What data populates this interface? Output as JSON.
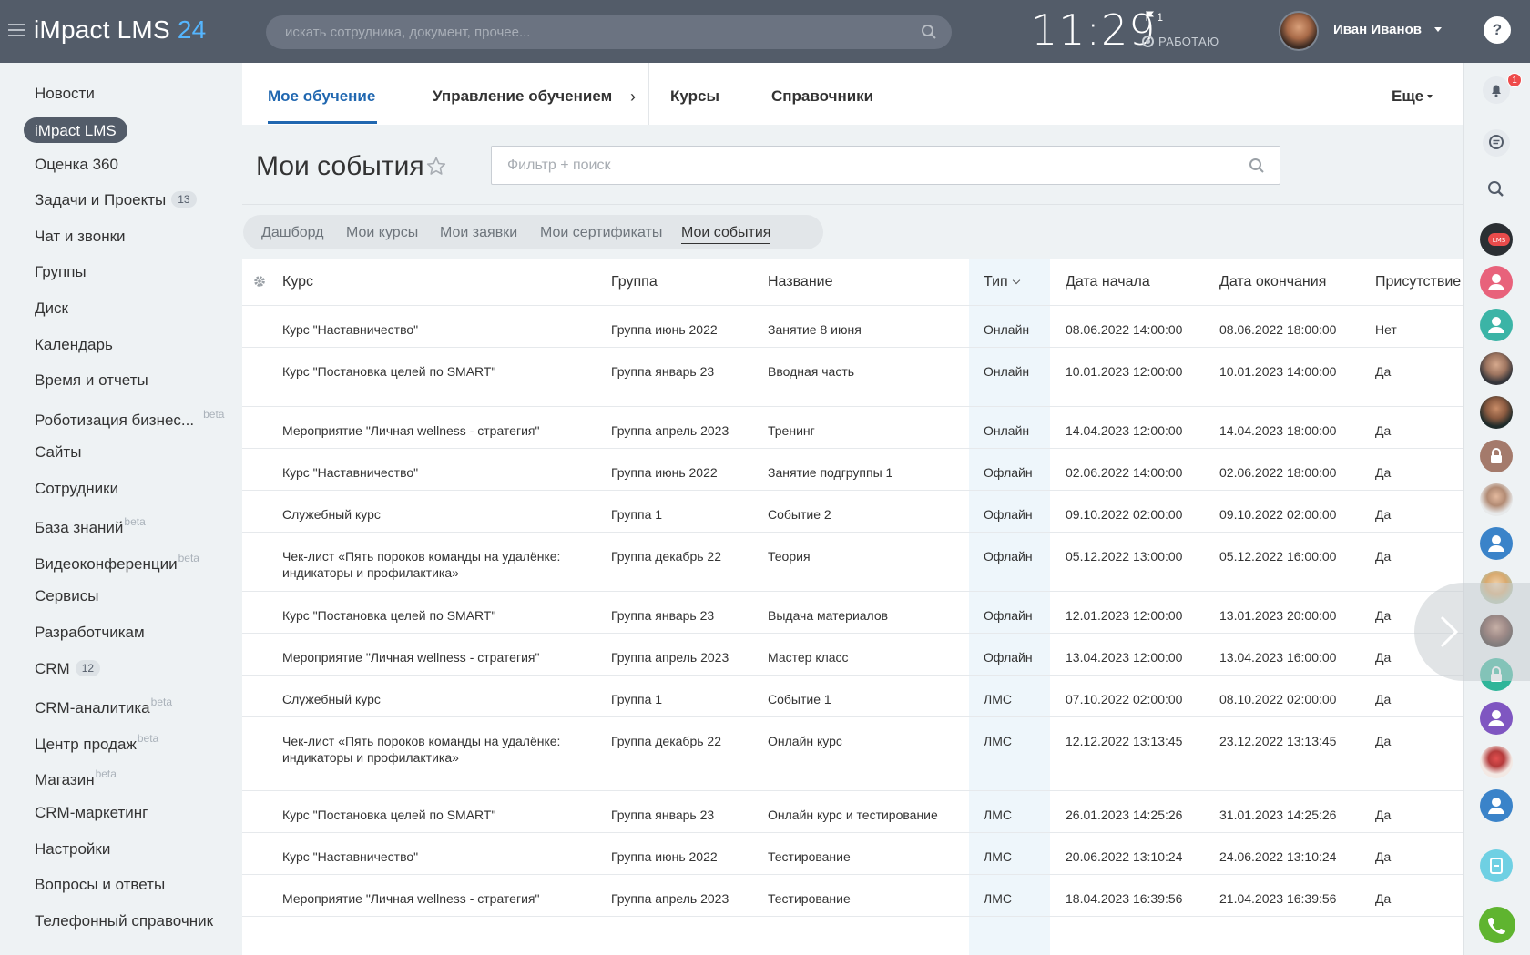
{
  "header": {
    "logo_main": "iMpact LMS",
    "logo_num": "24",
    "search_placeholder": "искать сотрудника, документ, прочее...",
    "time": "11:29",
    "flag_count": "1",
    "work_status": "РАБОТАЮ",
    "user_name": "Иван Иванов",
    "help": "?"
  },
  "sidebar": {
    "active": "iMpact LMS",
    "items": [
      {
        "label": "Новости"
      },
      {
        "label": "Оценка 360"
      },
      {
        "label": "Задачи и Проекты",
        "count": "13"
      },
      {
        "label": "Чат и звонки"
      },
      {
        "label": "Группы"
      },
      {
        "label": "Диск"
      },
      {
        "label": "Календарь"
      },
      {
        "label": "Время и отчеты"
      },
      {
        "label": "Роботизация бизнес...",
        "beta": "beta"
      },
      {
        "label": "Сайты"
      },
      {
        "label": "Сотрудники"
      },
      {
        "label": "База знаний",
        "beta": "beta"
      },
      {
        "label": "Видеоконференции",
        "beta": "beta"
      },
      {
        "label": "Сервисы"
      },
      {
        "label": "Разработчикам"
      },
      {
        "label": "CRM",
        "count": "12"
      },
      {
        "label": "CRM-аналитика",
        "beta": "beta"
      },
      {
        "label": "Центр продаж",
        "beta": "beta"
      },
      {
        "label": "Магазин",
        "beta": "beta"
      },
      {
        "label": "CRM-маркетинг"
      },
      {
        "label": "Настройки"
      },
      {
        "label": "Вопросы и ответы"
      },
      {
        "label": "Телефонный справочник"
      }
    ]
  },
  "tabs": {
    "my_learning": "Мое обучение",
    "management": "Управление обучением",
    "chevron": "›",
    "courses": "Курсы",
    "refs": "Справочники",
    "more": "Еще"
  },
  "page": {
    "title": "Мои события",
    "filter_placeholder": "Фильтр + поиск"
  },
  "subtabs": [
    "Дашборд",
    "Мои курсы",
    "Мои заявки",
    "Мои сертификаты",
    "Мои события"
  ],
  "table": {
    "headers": {
      "course": "Курс",
      "group": "Группа",
      "name": "Название",
      "type": "Тип",
      "start": "Дата начала",
      "end": "Дата окончания",
      "presence": "Присутствие"
    },
    "rows": [
      {
        "course": "Курс \"Наставничество\"",
        "group": "Группа июнь 2022",
        "name": "Занятие 8 июня",
        "type": "Онлайн",
        "start": "08.06.2022 14:00:00",
        "end": "08.06.2022 18:00:00",
        "presence": "Нет"
      },
      {
        "course": "Курс \"Постановка целей по SMART\"",
        "group": "Группа январь 23",
        "name": "Вводная часть",
        "type": "Онлайн",
        "start": "10.01.2023 12:00:00",
        "end": "10.01.2023 14:00:00",
        "presence": "Да"
      },
      {
        "course": "Мероприятие \"Личная wellness - стратегия\"",
        "group": "Группа апрель 2023",
        "name": "Тренинг",
        "type": "Онлайн",
        "start": "14.04.2023 12:00:00",
        "end": "14.04.2023 18:00:00",
        "presence": "Да"
      },
      {
        "course": "Курс \"Наставничество\"",
        "group": "Группа июнь 2022",
        "name": "Занятие подгруппы 1",
        "type": "Офлайн",
        "start": "02.06.2022 14:00:00",
        "end": "02.06.2022 18:00:00",
        "presence": "Да"
      },
      {
        "course": "Служебный курс",
        "group": "Группа 1",
        "name": "Событие 2",
        "type": "Офлайн",
        "start": "09.10.2022 02:00:00",
        "end": "09.10.2022 02:00:00",
        "presence": "Да"
      },
      {
        "course": "Чек-лист «Пять пороков команды на удалёнке: индикаторы и профилактика»",
        "group": "Группа декабрь 22",
        "name": "Теория",
        "type": "Офлайн",
        "start": "05.12.2022 13:00:00",
        "end": "05.12.2022 16:00:00",
        "presence": "Да"
      },
      {
        "course": "Курс \"Постановка целей по SMART\"",
        "group": "Группа январь 23",
        "name": "Выдача материалов",
        "type": "Офлайн",
        "start": "12.01.2023 12:00:00",
        "end": "13.01.2023 20:00:00",
        "presence": "Да"
      },
      {
        "course": "Мероприятие \"Личная wellness - стратегия\"",
        "group": "Группа апрель 2023",
        "name": "Мастер класс",
        "type": "Офлайн",
        "start": "13.04.2023 12:00:00",
        "end": "13.04.2023 16:00:00",
        "presence": "Да"
      },
      {
        "course": "Служебный курс",
        "group": "Группа 1",
        "name": "Событие 1",
        "type": "ЛМС",
        "start": "07.10.2022 02:00:00",
        "end": "08.10.2022 02:00:00",
        "presence": "Да"
      },
      {
        "course": "Чек-лист «Пять пороков команды на удалёнке: индикаторы и профилактика»",
        "group": "Группа декабрь 22",
        "name": "Онлайн курс",
        "type": "ЛМС",
        "start": "12.12.2022 13:13:45",
        "end": "23.12.2022 13:13:45",
        "presence": "Да"
      },
      {
        "course": "Курс \"Постановка целей по SMART\"",
        "group": "Группа январь 23",
        "name": "Онлайн курс и тестирование",
        "type": "ЛМС",
        "start": "26.01.2023 14:25:26",
        "end": "31.01.2023 14:25:26",
        "presence": "Да"
      },
      {
        "course": "Курс \"Наставничество\"",
        "group": "Группа июнь 2022",
        "name": "Тестирование",
        "type": "ЛМС",
        "start": "20.06.2022 13:10:24",
        "end": "24.06.2022 13:10:24",
        "presence": "Да"
      },
      {
        "course": "Мероприятие \"Личная wellness - стратегия\"",
        "group": "Группа апрель 2023",
        "name": "Тестирование",
        "type": "ЛМС",
        "start": "18.04.2023 16:39:56",
        "end": "21.04.2023 16:39:56",
        "presence": "Да"
      }
    ]
  },
  "rightbar": {
    "notif_count": "1",
    "lms_label": "LMS",
    "icons": [
      "bell-icon",
      "chat-icon",
      "search-icon",
      "lms-icon",
      "user-icon",
      "lock-icon",
      "phone-icon"
    ]
  },
  "colors": {
    "topbar": "#535c69",
    "accent": "#2067b0",
    "logo_num": "#55b6ff",
    "type_column": "#eef6fb",
    "call_button": "#5fb42f",
    "badge_red": "#ee4b4b"
  }
}
